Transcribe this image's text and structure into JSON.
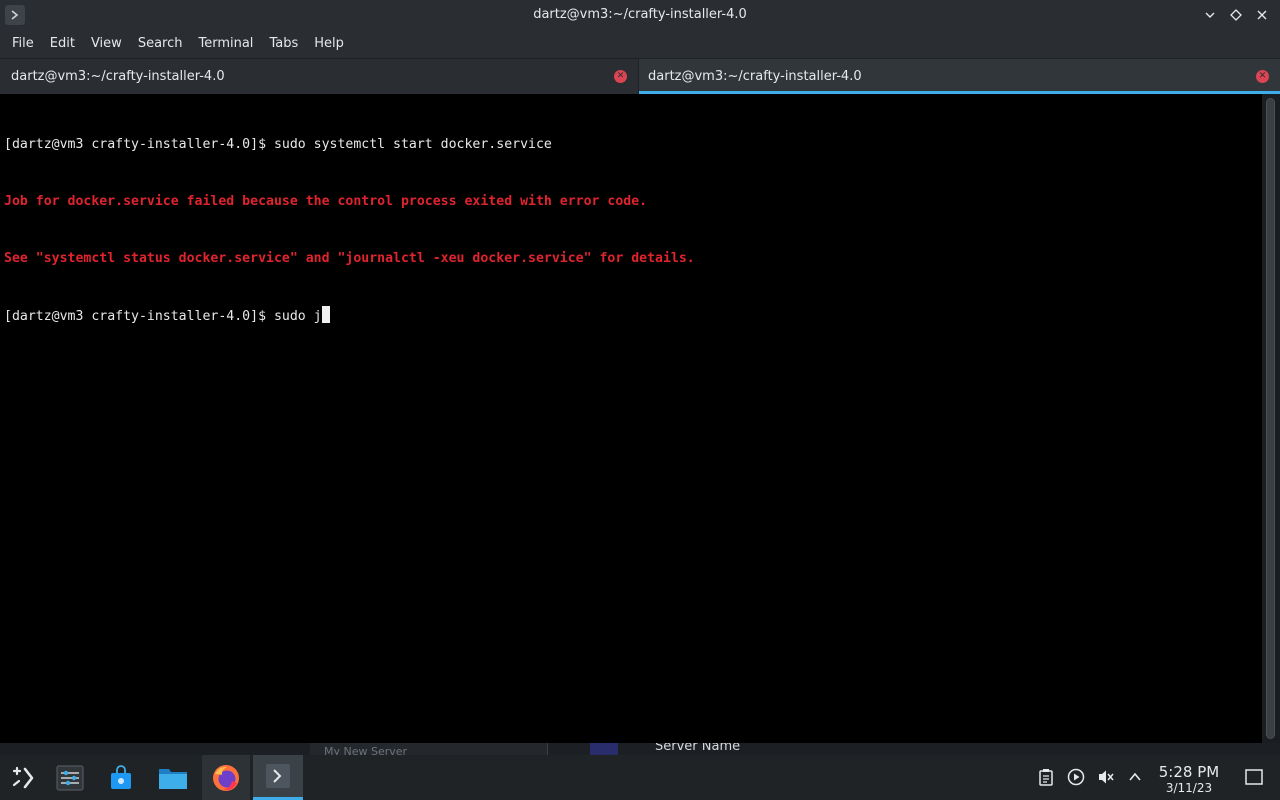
{
  "window": {
    "title": "dartz@vm3:~/crafty-installer-4.0",
    "app_icon": "terminal-icon",
    "controls": [
      "minimize-icon",
      "maximize-icon",
      "close-icon"
    ]
  },
  "menubar": {
    "items": [
      "File",
      "Edit",
      "View",
      "Search",
      "Terminal",
      "Tabs",
      "Help"
    ]
  },
  "tabs": [
    {
      "label": "dartz@vm3:~/crafty-installer-4.0",
      "active": false
    },
    {
      "label": "dartz@vm3:~/crafty-installer-4.0",
      "active": true
    }
  ],
  "terminal": {
    "lines": [
      {
        "text": "[dartz@vm3 crafty-installer-4.0]$ sudo systemctl start docker.service",
        "type": "normal"
      },
      {
        "text": "Job for docker.service failed because the control process exited with error code.",
        "type": "error"
      },
      {
        "text": "See \"systemctl status docker.service\" and \"journalctl -xeu docker.service\" for details.",
        "type": "error"
      },
      {
        "text": "[dartz@vm3 crafty-installer-4.0]$ sudo j",
        "type": "normal"
      }
    ]
  },
  "background_window": {
    "left_text": "My New Server",
    "right_text": "Server Name"
  },
  "taskbar": {
    "apps": [
      "application-launcher-icon",
      "system-settings-icon",
      "discover-store-icon",
      "file-manager-icon",
      "firefox-icon",
      "konsole-icon"
    ],
    "tray": [
      "clipboard-icon",
      "media-player-icon",
      "volume-muted-icon",
      "expand-tray-icon"
    ],
    "clock": {
      "time": "5:28 PM",
      "date": "3/11/23"
    },
    "show_desktop": "show-desktop-icon"
  },
  "colors": {
    "accent": "#3daee9",
    "error_text": "#e0242e",
    "tab_close": "#da4453",
    "panel": "#2a2e32",
    "taskbar": "#202326"
  }
}
